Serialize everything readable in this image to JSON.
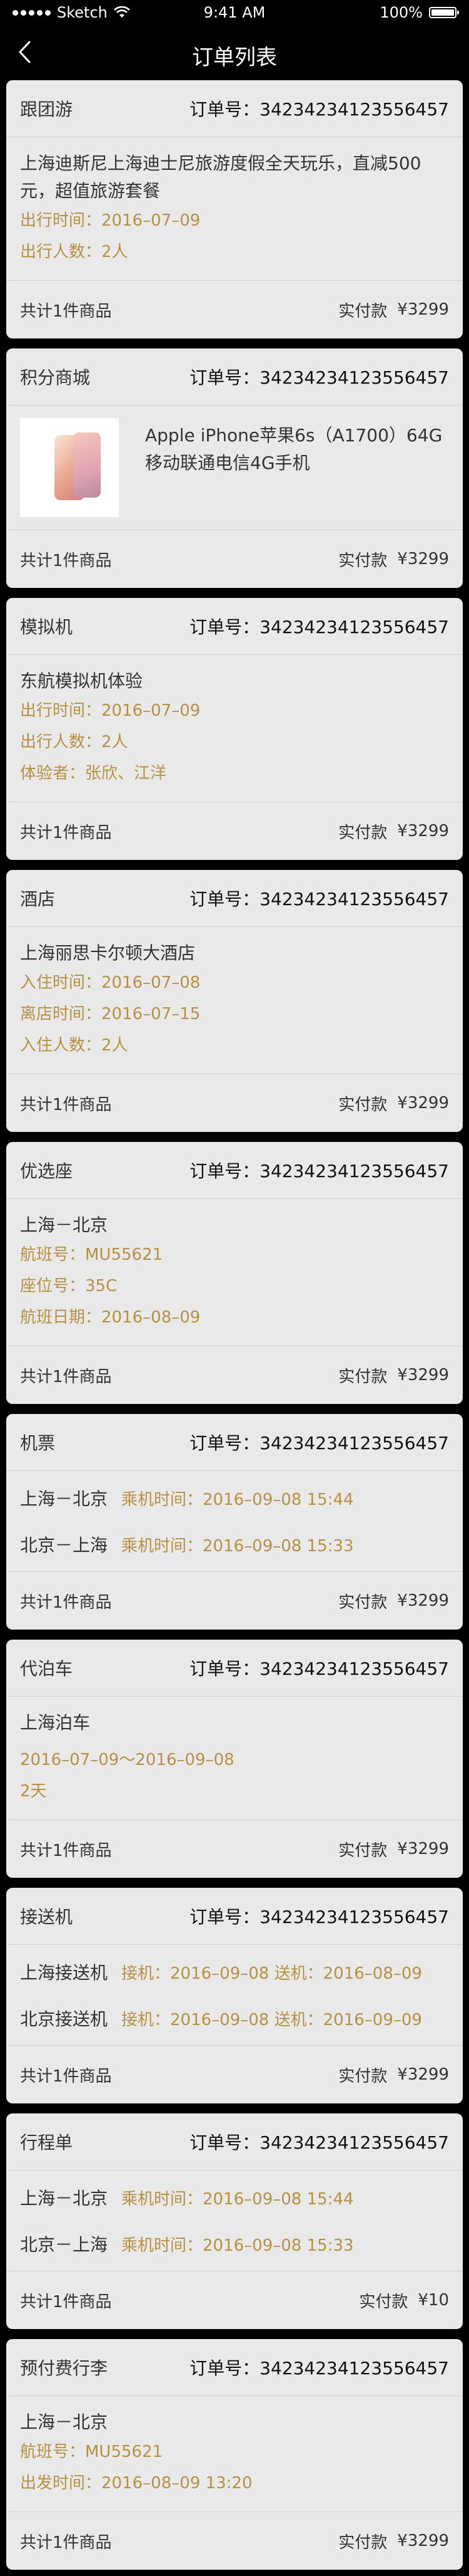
{
  "status": {
    "carrier": "Sketch",
    "time": "9:41 AM",
    "battery": "100%"
  },
  "nav": {
    "title": "订单列表"
  },
  "common": {
    "order_label": "订单号：",
    "count_label": "共计1件商品",
    "paid_label": "实付款"
  },
  "orders": [
    {
      "type": "跟团游",
      "order_no": "34234234123556457",
      "lines": [
        {
          "text": "上海迪斯尼上海迪士尼旅游度假全天玩乐，直减500元，超值旅游套餐",
          "style": "main"
        },
        {
          "text": "出行时间：2016–07–09",
          "style": "gold"
        },
        {
          "text": "出行人数：2人",
          "style": "gold"
        }
      ],
      "amount": "¥3299"
    },
    {
      "type": "积分商城",
      "order_no": "34234234123556457",
      "product": "Apple iPhone苹果6s（A1700）64G移动联通电信4G手机",
      "amount": "¥3299"
    },
    {
      "type": "模拟机",
      "order_no": "34234234123556457",
      "lines": [
        {
          "text": "东航模拟机体验",
          "style": "main"
        },
        {
          "text": "出行时间：2016–07–09",
          "style": "gold"
        },
        {
          "text": "出行人数：2人",
          "style": "gold"
        },
        {
          "text": "体验者：张欣、江洋",
          "style": "gold"
        }
      ],
      "amount": "¥3299"
    },
    {
      "type": "酒店",
      "order_no": "34234234123556457",
      "lines": [
        {
          "text": "上海丽思卡尔顿大酒店",
          "style": "main"
        },
        {
          "text": "入住时间：2016–07–08",
          "style": "gold"
        },
        {
          "text": "离店时间：2016–07–15",
          "style": "gold"
        },
        {
          "text": "入住人数：2人",
          "style": "gold"
        }
      ],
      "amount": "¥3299"
    },
    {
      "type": "优选座",
      "order_no": "34234234123556457",
      "lines": [
        {
          "text": "上海－北京",
          "style": "main"
        },
        {
          "text": "航班号：MU55621",
          "style": "gold"
        },
        {
          "text": "座位号：35C",
          "style": "gold"
        },
        {
          "text": "航班日期：2016–08–09",
          "style": "gold"
        }
      ],
      "amount": "¥3299"
    },
    {
      "type": "机票",
      "order_no": "34234234123556457",
      "routes": [
        {
          "route": "上海－北京",
          "info": "乘机时间：2016–09–08  15:44"
        },
        {
          "route": "北京－上海",
          "info": "乘机时间：2016–09–08  15:33"
        }
      ],
      "amount": "¥3299"
    },
    {
      "type": "代泊车",
      "order_no": "34234234123556457",
      "lines": [
        {
          "text": "上海泊车",
          "style": "main"
        },
        {
          "text": "2016–07–09～2016–09–08",
          "style": "gold"
        },
        {
          "text": "2天",
          "style": "gold"
        }
      ],
      "amount": "¥3299"
    },
    {
      "type": "接送机",
      "order_no": "34234234123556457",
      "routes": [
        {
          "route": "上海接送机",
          "info": "接机：2016–09–08  送机：2016–08–09"
        },
        {
          "route": "北京接送机",
          "info": "接机：2016–09–08  送机：2016–09–09"
        }
      ],
      "amount": "¥3299"
    },
    {
      "type": "行程单",
      "order_no": "34234234123556457",
      "routes": [
        {
          "route": "上海－北京",
          "info": "乘机时间：2016–09–08  15:44"
        },
        {
          "route": "北京－上海",
          "info": "乘机时间：2016–09–08  15:33"
        }
      ],
      "amount": "¥10"
    },
    {
      "type": "预付费行李",
      "order_no": "34234234123556457",
      "lines": [
        {
          "text": "上海－北京",
          "style": "main"
        },
        {
          "text": "航班号：MU55621",
          "style": "gold"
        },
        {
          "text": "出发时间：2016–08–09 13:20",
          "style": "gold"
        }
      ],
      "amount": "¥3299"
    }
  ]
}
